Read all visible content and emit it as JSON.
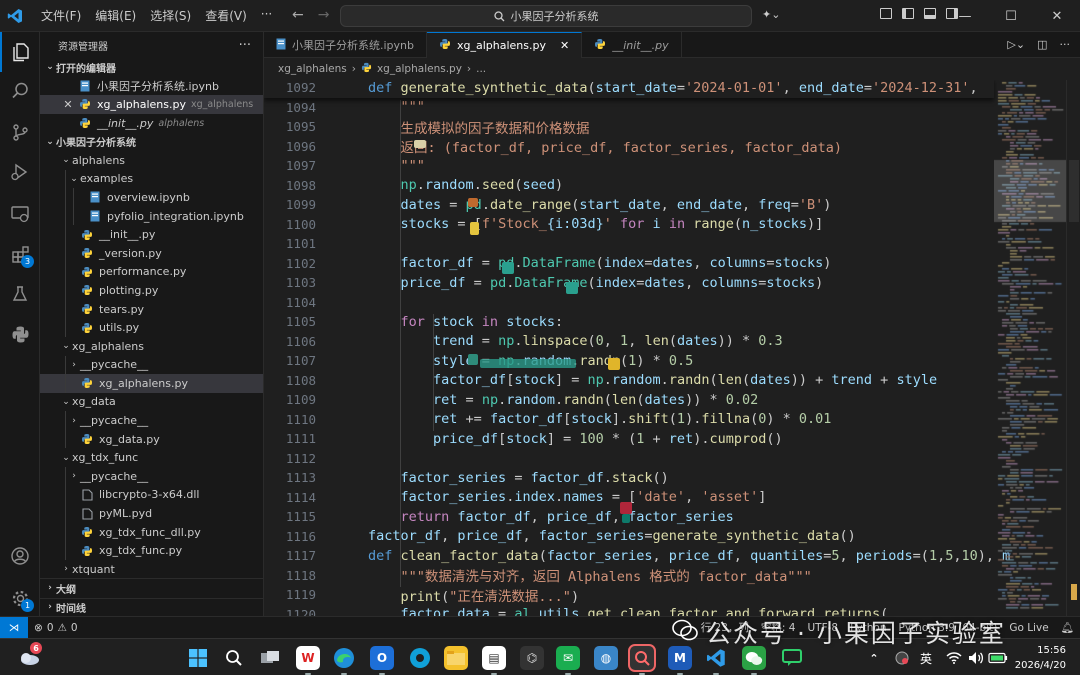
{
  "titlebar": {
    "menu": [
      "文件(F)",
      "编辑(E)",
      "选择(S)",
      "查看(V)",
      "···"
    ],
    "search_text": "小果因子分析系统"
  },
  "sidebar": {
    "title": "资源管理器",
    "more": "···",
    "open_editors_label": "打开的编辑器",
    "open_editors": [
      {
        "name": "小果因子分析系统.ipynb",
        "desc": ""
      },
      {
        "name": "xg_alphalens.py",
        "desc": "xg_alphalens"
      },
      {
        "name": "__init__.py",
        "desc": "alphalens"
      }
    ],
    "workspace_label": "小果因子分析系统",
    "tree": [
      {
        "label": "alphalens",
        "type": "folder",
        "depth": 1,
        "open": true
      },
      {
        "label": "examples",
        "type": "folder",
        "depth": 2,
        "open": true
      },
      {
        "label": "overview.ipynb",
        "type": "nb",
        "depth": 3
      },
      {
        "label": "pyfolio_integration.ipynb",
        "type": "nb",
        "depth": 3
      },
      {
        "label": "__init__.py",
        "type": "py",
        "depth": 2
      },
      {
        "label": "_version.py",
        "type": "py",
        "depth": 2
      },
      {
        "label": "performance.py",
        "type": "py",
        "depth": 2
      },
      {
        "label": "plotting.py",
        "type": "py",
        "depth": 2
      },
      {
        "label": "tears.py",
        "type": "py",
        "depth": 2
      },
      {
        "label": "utils.py",
        "type": "py",
        "depth": 2
      },
      {
        "label": "xg_alphalens",
        "type": "folder",
        "depth": 1,
        "open": true
      },
      {
        "label": "__pycache__",
        "type": "folder",
        "depth": 2,
        "open": false
      },
      {
        "label": "xg_alphalens.py",
        "type": "py",
        "depth": 2,
        "selected": true
      },
      {
        "label": "xg_data",
        "type": "folder",
        "depth": 1,
        "open": true
      },
      {
        "label": "__pycache__",
        "type": "folder",
        "depth": 2,
        "open": false
      },
      {
        "label": "xg_data.py",
        "type": "py",
        "depth": 2
      },
      {
        "label": "xg_tdx_func",
        "type": "folder",
        "depth": 1,
        "open": true
      },
      {
        "label": "__pycache__",
        "type": "folder",
        "depth": 2,
        "open": false
      },
      {
        "label": "libcrypto-3-x64.dll",
        "type": "dll",
        "depth": 2
      },
      {
        "label": "pyML.pyd",
        "type": "pyd",
        "depth": 2
      },
      {
        "label": "xg_tdx_func_dll.py",
        "type": "py",
        "depth": 2
      },
      {
        "label": "xg_tdx_func.py",
        "type": "py",
        "depth": 2
      },
      {
        "label": "xtquant",
        "type": "folder",
        "depth": 1,
        "open": false
      }
    ],
    "outline_label": "大纲",
    "timeline_label": "时间线"
  },
  "tabs": [
    {
      "label": "小果因子分析系统.ipynb",
      "active": false,
      "italic": false
    },
    {
      "label": "xg_alphalens.py",
      "active": true,
      "italic": false
    },
    {
      "label": "__init__.py",
      "active": false,
      "italic": true
    }
  ],
  "breadcrumb": [
    "xg_alphalens",
    "xg_alphalens.py",
    "..."
  ],
  "editor": {
    "lines": [
      {
        "n": "1092",
        "sticky": true
      },
      {
        "n": "1094"
      },
      {
        "n": "1095"
      },
      {
        "n": "1096"
      },
      {
        "n": "1097"
      },
      {
        "n": "1098"
      },
      {
        "n": "1099"
      },
      {
        "n": "1100"
      },
      {
        "n": "1101"
      },
      {
        "n": "1102"
      },
      {
        "n": "1103"
      },
      {
        "n": "1104"
      },
      {
        "n": "1105"
      },
      {
        "n": "1106"
      },
      {
        "n": "1107"
      },
      {
        "n": "1108"
      },
      {
        "n": "1109"
      },
      {
        "n": "1110"
      },
      {
        "n": "1111"
      },
      {
        "n": "1112"
      },
      {
        "n": "1113"
      },
      {
        "n": "1114"
      },
      {
        "n": "1115"
      },
      {
        "n": "1116"
      },
      {
        "n": "1117"
      },
      {
        "n": "1118"
      },
      {
        "n": "1119"
      },
      {
        "n": "1120"
      }
    ]
  },
  "code": {
    "l1092": [
      "def ",
      "generate_synthetic_data",
      "(",
      "start_date",
      "=",
      "'2024-01-01'",
      ", ",
      "end_date",
      "=",
      "'2024-12-31'",
      ","
    ],
    "l1094": "\"\"\"",
    "l1095": "生成模拟的因子数据和价格数据",
    "l1096": "返回: (factor_df, price_df, factor_series, factor_data)",
    "l1097": "\"\"\"",
    "l1098": [
      "np",
      ".",
      "random",
      ".",
      "seed",
      "(",
      "seed",
      ")"
    ],
    "l1099": [
      "dates",
      " = ",
      "pd",
      ".",
      "date_range",
      "(",
      "start_date",
      ", ",
      "end_date",
      ", ",
      "freq",
      "=",
      "'B'",
      ")"
    ],
    "l1100": [
      "stocks",
      " = ",
      "[",
      "f'Stock_",
      "{i:03d}",
      "'",
      " for ",
      "i",
      " in ",
      "range",
      "(",
      "n_stocks",
      ")]"
    ],
    "l1102": [
      "factor_df",
      " = ",
      "pd",
      ".",
      "DataFrame",
      "(",
      "index",
      "=",
      "dates",
      ", ",
      "columns",
      "=",
      "stocks",
      ")"
    ],
    "l1103": [
      "price_df",
      " = ",
      "pd",
      ".",
      "DataFrame",
      "(",
      "index",
      "=",
      "dates",
      ", ",
      "columns",
      "=",
      "stocks",
      ")"
    ],
    "l1105": [
      "for ",
      "stock",
      " in ",
      "stocks",
      ":"
    ],
    "l1106": [
      "trend",
      " = ",
      "np",
      ".",
      "linspace",
      "(",
      "0",
      ", ",
      "1",
      ", ",
      "len",
      "(",
      "dates",
      ")) * ",
      "0.3"
    ],
    "l1107": [
      "style",
      " = ",
      "np",
      ".",
      "random",
      ".",
      "randn",
      "(",
      "1",
      ") * ",
      "0.5"
    ],
    "l1108": [
      "factor_df",
      "[",
      "stock",
      "] = ",
      "np",
      ".",
      "random",
      ".",
      "randn",
      "(",
      "len",
      "(",
      "dates",
      ")) + ",
      "trend",
      " + ",
      "style"
    ],
    "l1109": [
      "ret",
      " = ",
      "np",
      ".",
      "random",
      ".",
      "randn",
      "(",
      "len",
      "(",
      "dates",
      ")) * ",
      "0.02"
    ],
    "l1110": [
      "ret",
      " += ",
      "factor_df",
      "[",
      "stock",
      "].",
      "shift",
      "(",
      "1",
      ").",
      "fillna",
      "(",
      "0",
      ") * ",
      "0.01"
    ],
    "l1111": [
      "price_df",
      "[",
      "stock",
      "] = ",
      "100",
      " * (",
      "1",
      " + ",
      "ret",
      ").",
      "cumprod",
      "()"
    ],
    "l1113": [
      "factor_series",
      " = ",
      "factor_df",
      ".",
      "stack",
      "()"
    ],
    "l1114": [
      "factor_series",
      ".",
      "index",
      ".",
      "names",
      " = ",
      "[",
      "'date'",
      ", ",
      "'asset'",
      "]"
    ],
    "l1115": [
      "return ",
      "factor_df",
      ", ",
      "price_df",
      ", ",
      "factor_series"
    ],
    "l1116": [
      "factor_df",
      ", ",
      "price_df",
      ", ",
      "factor_series",
      "=",
      "generate_synthetic_data",
      "()"
    ],
    "l1117": [
      "def ",
      "clean_factor_data",
      "(",
      "factor_series",
      ", ",
      "price_df",
      ", ",
      "quantiles",
      "=",
      "5",
      ", ",
      "periods",
      "=(",
      "1",
      ",",
      "5",
      ",",
      "10",
      "), ",
      "m"
    ],
    "l1118": "\"\"\"数据清洗与对齐，返回 Alphalens 格式的 factor_data\"\"\"",
    "l1119": [
      "print",
      "(",
      "\"正在清洗数据...\"",
      ")"
    ],
    "l1120": [
      "factor_data",
      " = ",
      "al",
      ".",
      "utils",
      ".",
      "get_clean_factor_and_forward_returns",
      "("
    ]
  },
  "statusbar": {
    "errors": "0",
    "warnings": "0",
    "position": "行 23，列",
    "spaces": "空格: 4",
    "encoding": "UTF-8",
    "lang": "Python",
    "interpreter": "Python 3.9 (64-bit)",
    "extra": "Go Live"
  },
  "watermark": "公众号 · 小果因子实验室",
  "taskbar": {
    "weather_badge": "6",
    "time": "15:56",
    "date": "2026/4/20",
    "ime": "英"
  },
  "colors": {
    "accent": "#0078d4",
    "editor_bg": "#1f1f1f",
    "sidebar_bg": "#181818",
    "keyword": "#569cd6",
    "function": "#dcdcaa",
    "string": "#ce9178",
    "number": "#b5cea8",
    "variable": "#9cdcfe"
  }
}
